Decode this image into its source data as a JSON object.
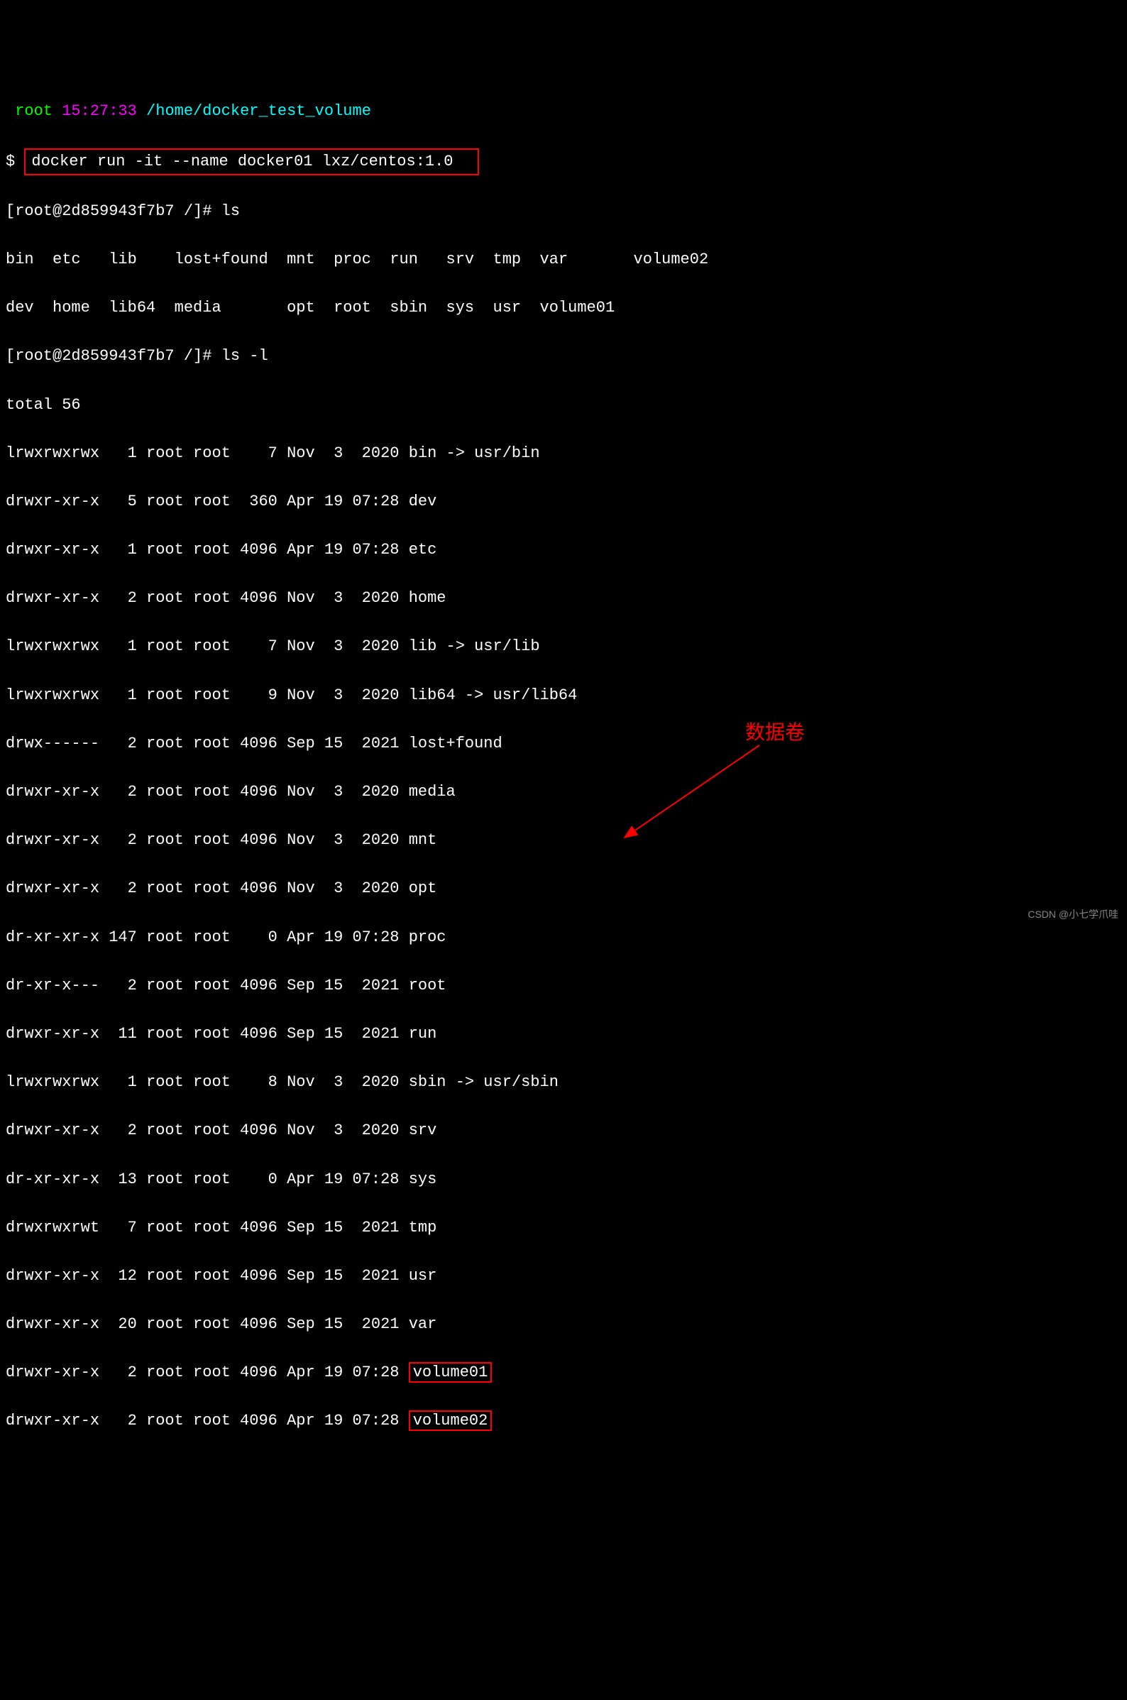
{
  "prompt1": {
    "user": " root ",
    "time": "15:27:33 ",
    "path": "/home/docker_test_volume  "
  },
  "cmd1": {
    "dollar": "$ ",
    "command": "docker run -it --name docker01 lxz/centos:1.0  "
  },
  "prompt2": "[root@2d859943f7b7 /]# ls",
  "ls_output": {
    "row1": "bin  etc   lib    lost+found  mnt  proc  run   srv  tmp  var       volume02",
    "row2": "dev  home  lib64  media       opt  root  sbin  sys  usr  volume01"
  },
  "prompt3": "[root@2d859943f7b7 /]# ls -l",
  "total": "total 56",
  "entries": [
    "lrwxrwxrwx   1 root root    7 Nov  3  2020 bin -> usr/bin",
    "drwxr-xr-x   5 root root  360 Apr 19 07:28 dev",
    "drwxr-xr-x   1 root root 4096 Apr 19 07:28 etc",
    "drwxr-xr-x   2 root root 4096 Nov  3  2020 home",
    "lrwxrwxrwx   1 root root    7 Nov  3  2020 lib -> usr/lib",
    "lrwxrwxrwx   1 root root    9 Nov  3  2020 lib64 -> usr/lib64",
    "drwx------   2 root root 4096 Sep 15  2021 lost+found",
    "drwxr-xr-x   2 root root 4096 Nov  3  2020 media",
    "drwxr-xr-x   2 root root 4096 Nov  3  2020 mnt",
    "drwxr-xr-x   2 root root 4096 Nov  3  2020 opt",
    "dr-xr-xr-x 147 root root    0 Apr 19 07:28 proc",
    "dr-xr-x---   2 root root 4096 Sep 15  2021 root",
    "drwxr-xr-x  11 root root 4096 Sep 15  2021 run",
    "lrwxrwxrwx   1 root root    8 Nov  3  2020 sbin -> usr/sbin",
    "drwxr-xr-x   2 root root 4096 Nov  3  2020 srv",
    "dr-xr-xr-x  13 root root    0 Apr 19 07:28 sys",
    "drwxrwxrwt   7 root root 4096 Sep 15  2021 tmp",
    "drwxr-xr-x  12 root root 4096 Sep 15  2021 usr",
    "drwxr-xr-x  20 root root 4096 Sep 15  2021 var"
  ],
  "vol_prefix": "drwxr-xr-x   2 root root 4096 Apr 19 07:28 ",
  "vol1": "volume01",
  "vol2": "volume02",
  "annotation_label": "数据卷",
  "watermark": "CSDN @小七学爪哇"
}
